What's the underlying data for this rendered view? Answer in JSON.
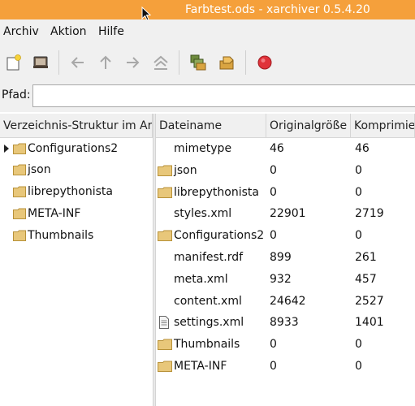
{
  "window": {
    "title": "Farbtest.ods - xarchiver 0.5.4.20"
  },
  "menubar": {
    "items": [
      "Archiv",
      "Aktion",
      "Hilfe"
    ]
  },
  "toolbar": {
    "icons": [
      "new-archive-icon",
      "open-archive-icon",
      "back-icon",
      "up-icon",
      "forward-icon",
      "home-icon",
      "extract-icon",
      "add-icon",
      "stop-icon"
    ],
    "colors": {
      "accent": "#f5a03b",
      "stop": "#e0323a",
      "folder": "#e8c77a"
    }
  },
  "pathbar": {
    "label": "Pfad:",
    "value": ""
  },
  "tree": {
    "header": "Verzeichnis-Struktur im Archiv",
    "items": [
      {
        "label": "Configurations2",
        "expandable": true
      },
      {
        "label": "json",
        "expandable": false
      },
      {
        "label": "librepythonista",
        "expandable": false
      },
      {
        "label": "META-INF",
        "expandable": false
      },
      {
        "label": "Thumbnails",
        "expandable": false
      }
    ]
  },
  "filelist": {
    "columns": [
      "Dateiname",
      "Originalgröße",
      "Komprimiert"
    ],
    "rows": [
      {
        "name": "mimetype",
        "original": "46",
        "compressed": "46",
        "icon": "none"
      },
      {
        "name": "json",
        "original": "0",
        "compressed": "0",
        "icon": "folder-icon"
      },
      {
        "name": "librepythonista",
        "original": "0",
        "compressed": "0",
        "icon": "folder-icon"
      },
      {
        "name": "styles.xml",
        "original": "22901",
        "compressed": "2719",
        "icon": "none"
      },
      {
        "name": "Configurations2",
        "original": "0",
        "compressed": "0",
        "icon": "folder-icon"
      },
      {
        "name": "manifest.rdf",
        "original": "899",
        "compressed": "261",
        "icon": "none"
      },
      {
        "name": "meta.xml",
        "original": "932",
        "compressed": "457",
        "icon": "none"
      },
      {
        "name": "content.xml",
        "original": "24642",
        "compressed": "2527",
        "icon": "none"
      },
      {
        "name": "settings.xml",
        "original": "8933",
        "compressed": "1401",
        "icon": "document-icon"
      },
      {
        "name": "Thumbnails",
        "original": "0",
        "compressed": "0",
        "icon": "folder-icon"
      },
      {
        "name": "META-INF",
        "original": "0",
        "compressed": "0",
        "icon": "folder-icon"
      }
    ]
  }
}
